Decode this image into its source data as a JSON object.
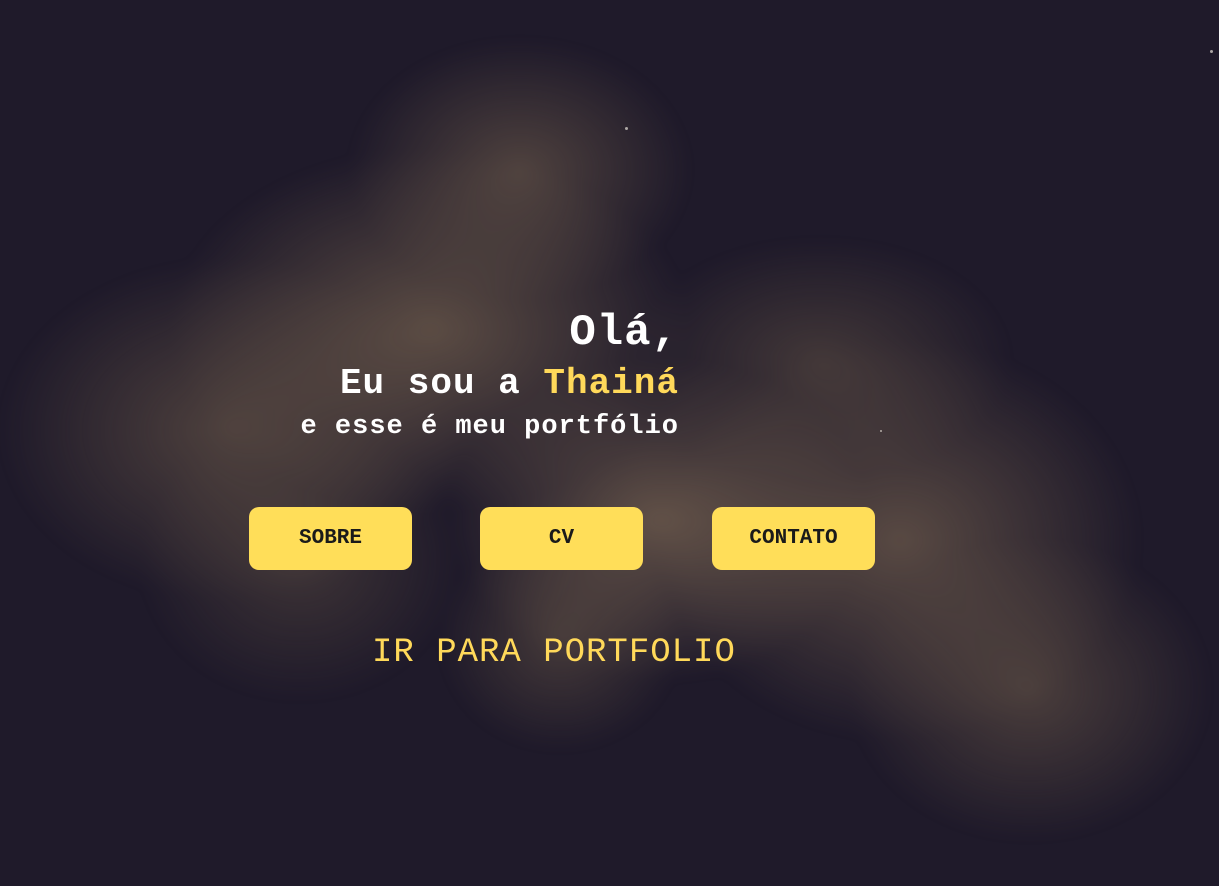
{
  "hero": {
    "greeting": "Olá,",
    "intro_prefix": "Eu sou a ",
    "name": "Thainá",
    "subtitle": "e esse é meu portfólio"
  },
  "nav": {
    "buttons": [
      {
        "label": "SOBRE"
      },
      {
        "label": "CV"
      },
      {
        "label": "CONTATO"
      }
    ]
  },
  "portfolio_link": {
    "label": "IR PARA PORTFOLIO"
  },
  "colors": {
    "background": "#1f1a2a",
    "accent": "#ffde59",
    "text": "#ffffff",
    "smoke": "#7d6852"
  }
}
